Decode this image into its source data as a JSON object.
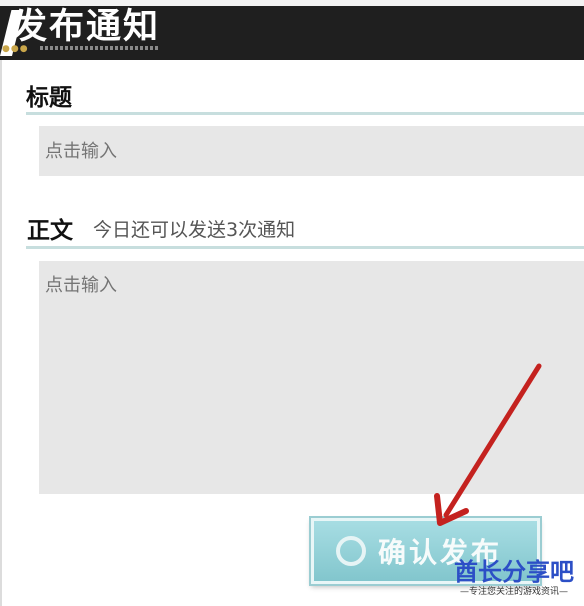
{
  "header": {
    "title": "发布通知"
  },
  "title_section": {
    "label": "标题",
    "placeholder": "点击输入"
  },
  "body_section": {
    "label": "正文",
    "hint": "今日还可以发送3次通知",
    "placeholder": "点击输入"
  },
  "confirm_button": {
    "label": "确认发布"
  },
  "watermark": {
    "title": "酋长分享吧",
    "subtitle": "—专注您关注的游戏资讯—"
  },
  "colors": {
    "header_bg": "#1f1f1f",
    "button_teal": "#8fcdd3",
    "arrow_red": "#c4221f",
    "watermark_blue": "#2c4fc6"
  }
}
